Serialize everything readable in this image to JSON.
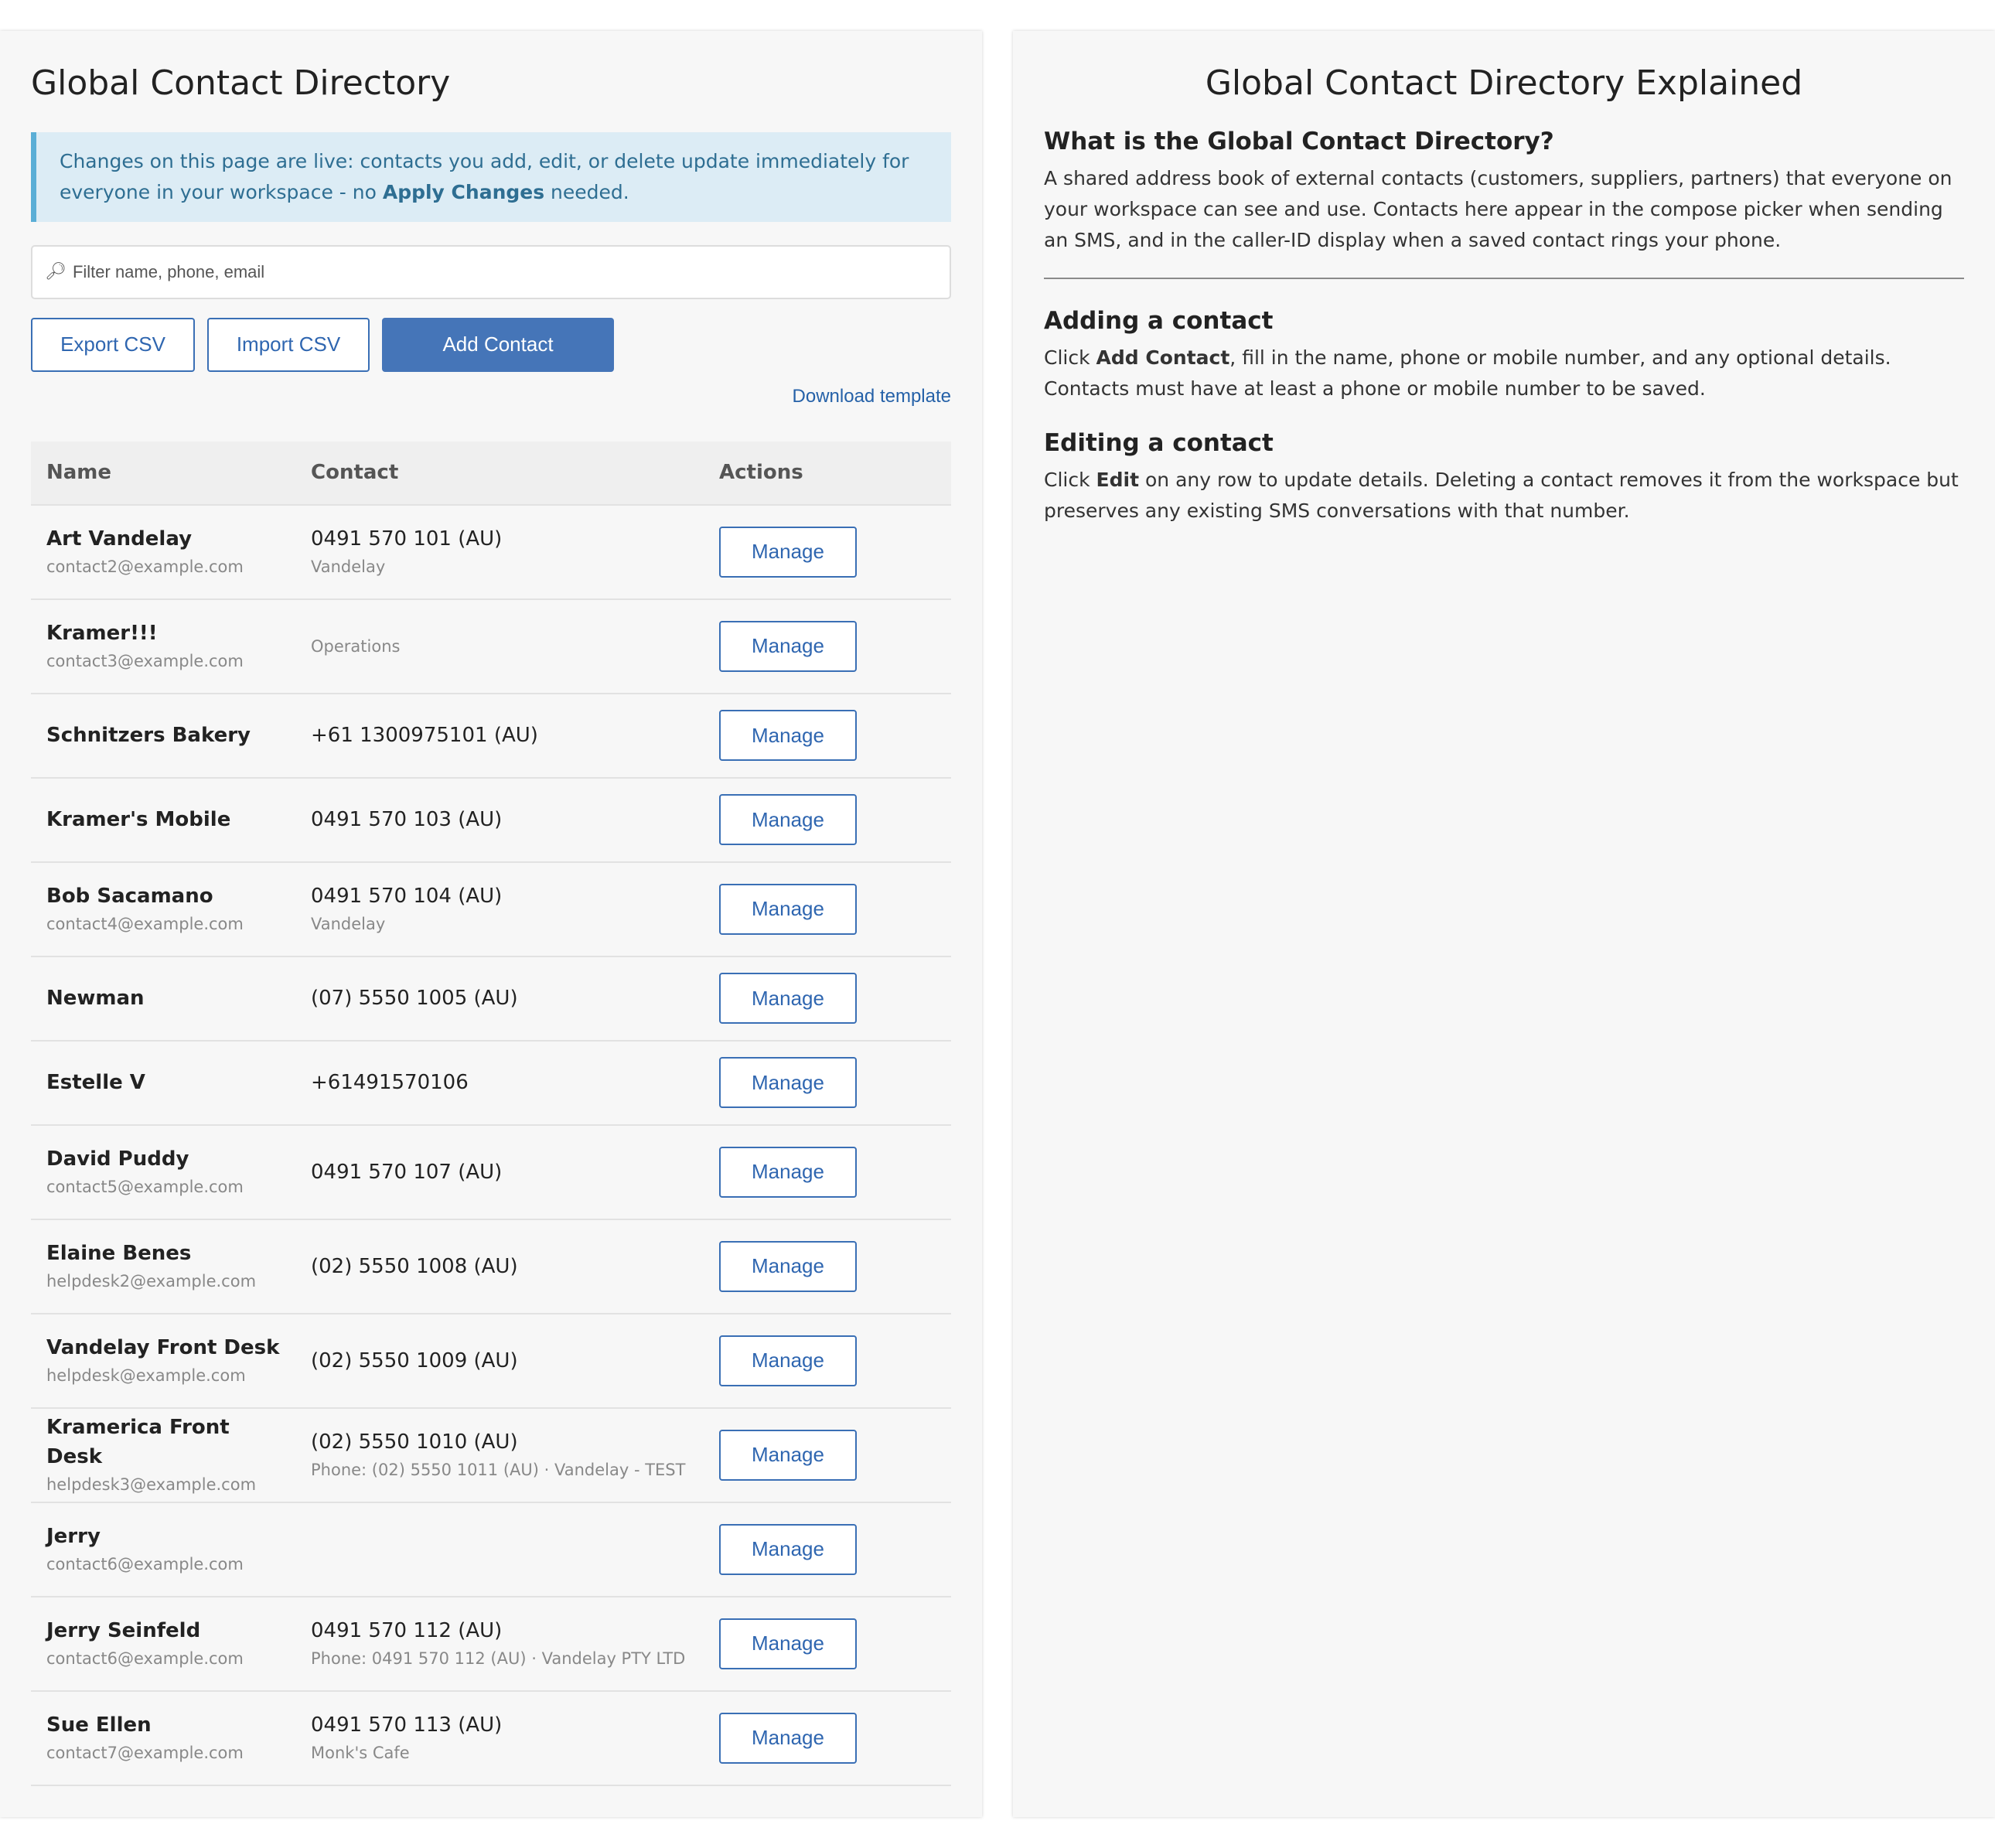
{
  "left": {
    "title": "Global Contact Directory",
    "notice": {
      "prefix": "Changes on this page are live: contacts you add, edit, or delete update immediately for everyone in your workspace - no ",
      "bold": "Apply Changes",
      "suffix": " needed."
    },
    "filter": {
      "icon": "search-icon",
      "placeholder": "Filter name, phone, email"
    },
    "buttons": {
      "export": "Export CSV",
      "import": "Import CSV",
      "add": "Add Contact"
    },
    "download_template": "Download template",
    "table": {
      "headers": {
        "name": "Name",
        "contact": "Contact",
        "actions": "Actions"
      },
      "manage_label": "Manage",
      "rows": [
        {
          "name": "Art Vandelay",
          "email": "contact2@example.com",
          "phone": "0491 570 101 (AU)",
          "sub": "Vandelay"
        },
        {
          "name": "Kramer!!!",
          "email": "contact3@example.com",
          "phone": "",
          "sub": "Operations"
        },
        {
          "name": "Schnitzers Bakery",
          "email": "",
          "phone": "+61 1300975101 (AU)",
          "sub": ""
        },
        {
          "name": "Kramer's Mobile",
          "email": "",
          "phone": "0491 570 103 (AU)",
          "sub": ""
        },
        {
          "name": "Bob Sacamano",
          "email": "contact4@example.com",
          "phone": "0491 570 104 (AU)",
          "sub": "Vandelay"
        },
        {
          "name": "Newman",
          "email": "",
          "phone": "(07) 5550 1005 (AU)",
          "sub": ""
        },
        {
          "name": "Estelle V",
          "email": "",
          "phone": "+61491570106",
          "sub": ""
        },
        {
          "name": "David Puddy",
          "email": "contact5@example.com",
          "phone": "0491 570 107 (AU)",
          "sub": ""
        },
        {
          "name": "Elaine Benes",
          "email": "helpdesk2@example.com",
          "phone": "(02) 5550 1008 (AU)",
          "sub": ""
        },
        {
          "name": "Vandelay Front Desk",
          "email": "helpdesk@example.com",
          "phone": "(02) 5550 1009 (AU)",
          "sub": ""
        },
        {
          "name": "Kramerica Front Desk",
          "email": "helpdesk3@example.com",
          "phone": "(02) 5550 1010 (AU)",
          "sub": "Phone: (02) 5550 1011 (AU) · Vandelay - TEST"
        },
        {
          "name": "Jerry",
          "email": "contact6@example.com",
          "phone": "",
          "sub": ""
        },
        {
          "name": "Jerry Seinfeld",
          "email": "contact6@example.com",
          "phone": "0491 570 112 (AU)",
          "sub": "Phone: 0491 570 112 (AU) · Vandelay PTY LTD"
        },
        {
          "name": "Sue Ellen",
          "email": "contact7@example.com",
          "phone": "0491 570 113 (AU)",
          "sub": "Monk's Cafe"
        }
      ]
    }
  },
  "right": {
    "title": "Global Contact Directory Explained",
    "what": {
      "heading": "What is the Global Contact Directory?",
      "body": "A shared address book of external contacts (customers, suppliers, partners) that everyone on your workspace can see and use. Contacts here appear in the compose picker when sending an SMS, and in the caller-ID display when a saved contact rings your phone."
    },
    "adding": {
      "heading": "Adding a contact",
      "prefix": "Click ",
      "bold": "Add Contact",
      "suffix": ", fill in the name, phone or mobile number, and any optional details. Contacts must have at least a phone or mobile number to be saved."
    },
    "editing": {
      "heading": "Editing a contact",
      "prefix": "Click ",
      "bold": "Edit",
      "suffix": " on any row to update details. Deleting a contact removes it from the workspace but preserves any existing SMS conversations with that number."
    }
  }
}
